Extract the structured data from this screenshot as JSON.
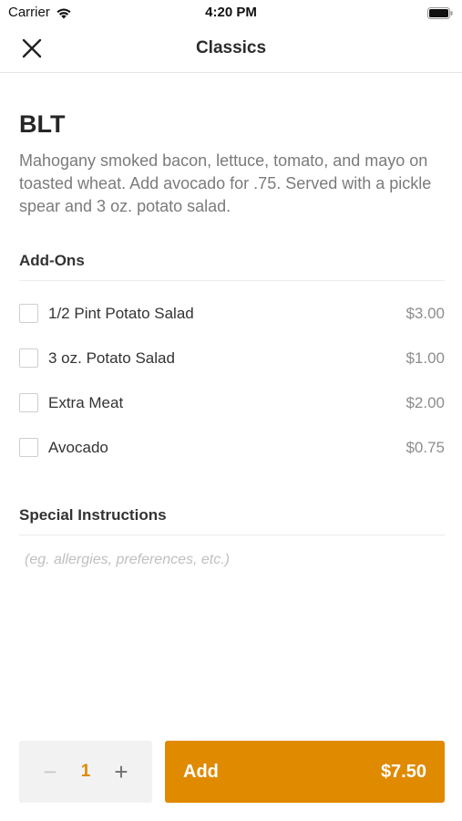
{
  "status_bar": {
    "carrier": "Carrier",
    "time": "4:20 PM"
  },
  "nav": {
    "title": "Classics",
    "close_icon": "close-icon"
  },
  "item": {
    "title": "BLT",
    "description": "Mahogany smoked bacon, lettuce, tomato, and mayo on toasted wheat. Add avocado for .75. Served with a pickle spear and 3 oz. potato salad."
  },
  "addons": {
    "header": "Add-Ons",
    "items": [
      {
        "name": "1/2 Pint Potato Salad",
        "price": "$3.00",
        "checked": false
      },
      {
        "name": "3 oz. Potato Salad",
        "price": "$1.00",
        "checked": false
      },
      {
        "name": "Extra Meat",
        "price": "$2.00",
        "checked": false
      },
      {
        "name": "Avocado",
        "price": "$0.75",
        "checked": false
      }
    ]
  },
  "special_instructions": {
    "header": "Special Instructions",
    "placeholder": "(eg. allergies, preferences, etc.)",
    "value": ""
  },
  "footer": {
    "quantity": "1",
    "minus_symbol": "−",
    "plus_symbol": "+",
    "add_label": "Add",
    "total": "$7.50"
  },
  "colors": {
    "accent": "#e08a00",
    "stepper_bg": "#f2f2f2",
    "muted_text": "#7b7b7b"
  }
}
